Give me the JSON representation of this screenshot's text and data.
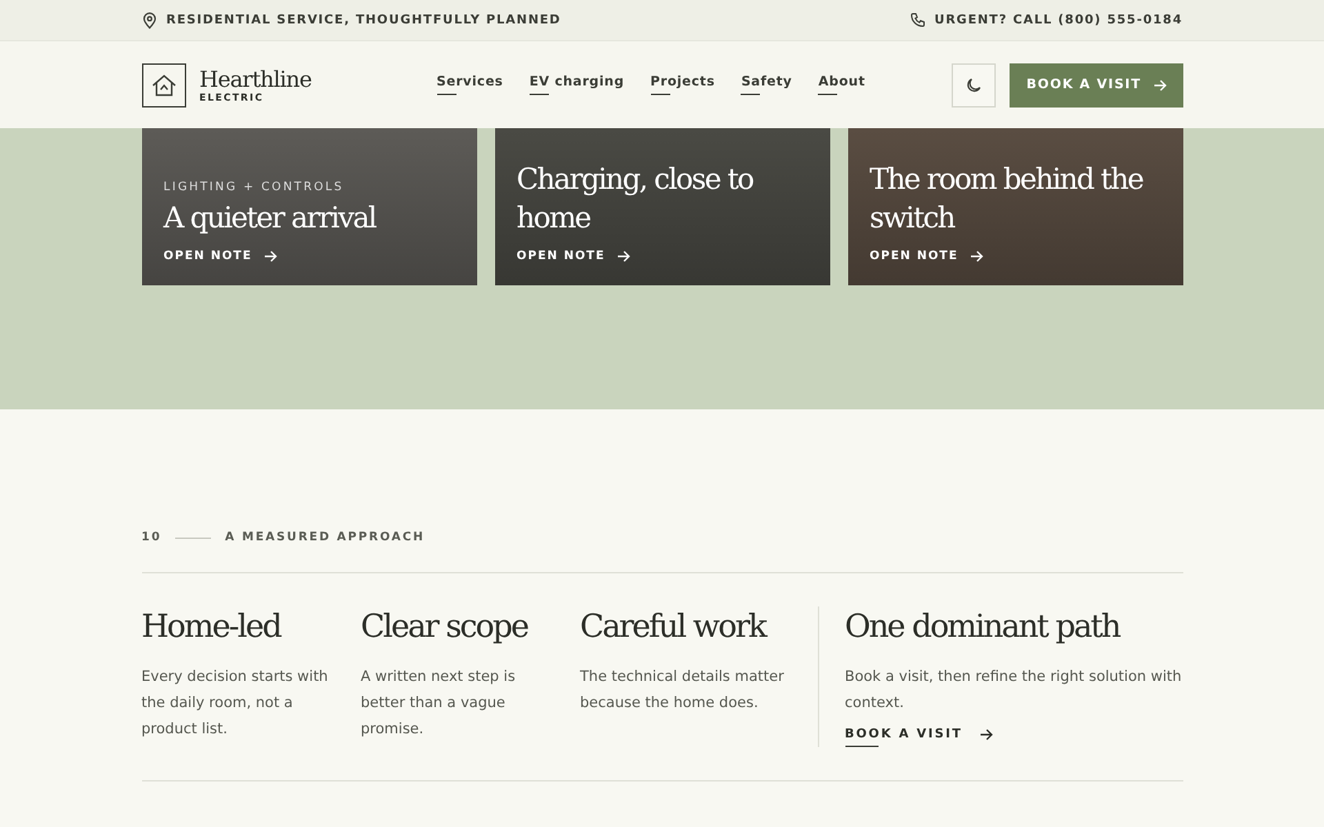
{
  "top_bar": {
    "tagline": "RESIDENTIAL SERVICE, THOUGHTFULLY PLANNED",
    "phone": "URGENT? CALL (800) 555-0184"
  },
  "header": {
    "brand": "Hearthline",
    "brand_sub": "ELECTRIC",
    "nav": [
      {
        "label": "Services"
      },
      {
        "label": "EV charging"
      },
      {
        "label": "Projects"
      },
      {
        "label": "Safety"
      },
      {
        "label": "About"
      }
    ],
    "cta": "BOOK A VISIT"
  },
  "cards": [
    {
      "kicker": "LIGHTING + CONTROLS",
      "title": "A quieter arrival",
      "link": "OPEN NOTE"
    },
    {
      "title": "Charging, close to home",
      "link": "OPEN NOTE"
    },
    {
      "title": "The room behind the switch",
      "link": "OPEN NOTE"
    }
  ],
  "approach": {
    "number": "10",
    "label": "A MEASURED APPROACH",
    "columns": [
      {
        "title": "Home-led",
        "text": "Every decision starts with the daily room, not a product list."
      },
      {
        "title": "Clear scope",
        "text": "A written next step is better than a vague promise."
      },
      {
        "title": "Careful work",
        "text": "The technical details matter because the home does."
      }
    ],
    "feature": {
      "title": "One dominant path",
      "text": "Book a visit, then refine the right solution with context.",
      "link": "BOOK A VISIT"
    }
  }
}
